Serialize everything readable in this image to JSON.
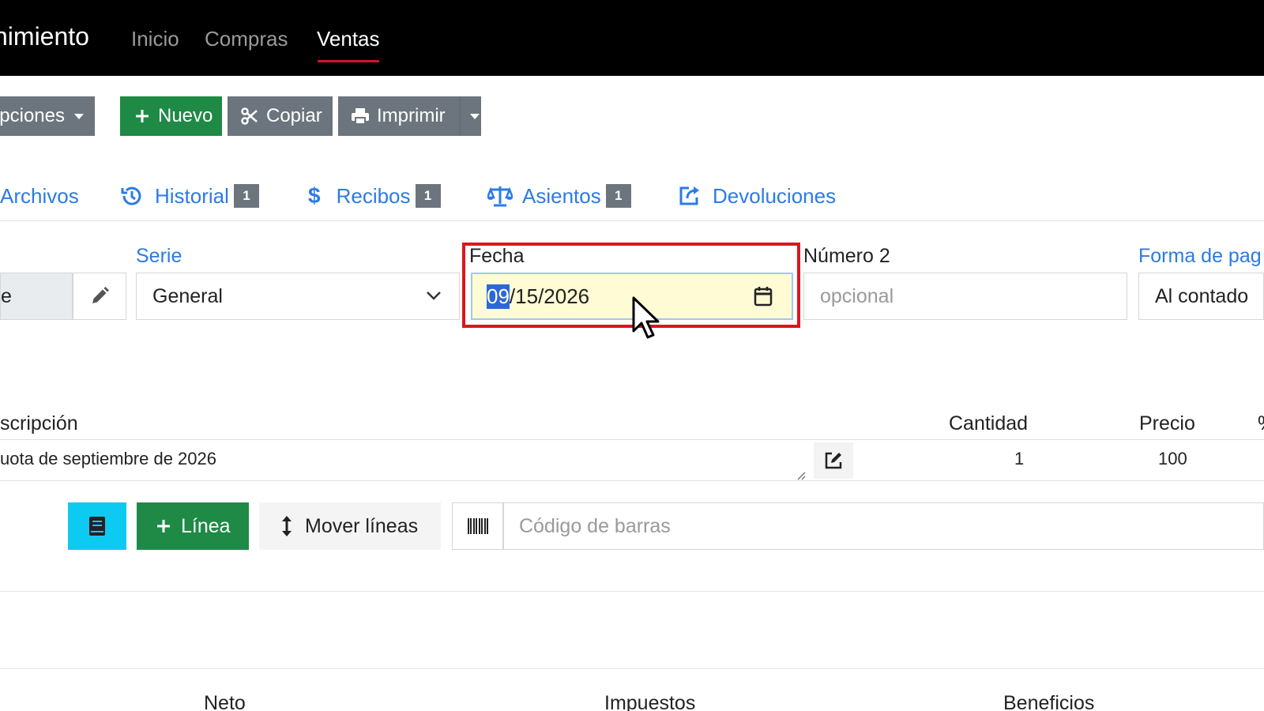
{
  "navbar": {
    "brand": "nimiento",
    "links": [
      {
        "label": "Inicio"
      },
      {
        "label": "Compras"
      },
      {
        "label": "Ventas",
        "active": true
      }
    ]
  },
  "toolbar": {
    "options_label": "pciones",
    "new_label": "Nuevo",
    "copy_label": "Copiar",
    "print_label": "Imprimir"
  },
  "tabs": [
    {
      "label": "Archivos",
      "icon": "paperclip-icon"
    },
    {
      "label": "Historial",
      "badge": "1",
      "icon": "history-icon"
    },
    {
      "label": "Recibos",
      "badge": "1",
      "icon": "dollar-icon"
    },
    {
      "label": "Asientos",
      "badge": "1",
      "icon": "balance-scale-icon"
    },
    {
      "label": "Devoluciones",
      "icon": "share-icon"
    }
  ],
  "form": {
    "customer_value": "e",
    "serie_label": "Serie",
    "serie_value": "General",
    "fecha_label": "Fecha",
    "fecha_month": "09",
    "fecha_rest": "/15/2026",
    "numero2_label": "Número 2",
    "numero2_placeholder": "opcional",
    "forma_pago_label": "Forma de pag",
    "forma_pago_value": "Al contado"
  },
  "lines": {
    "headers": {
      "descripcion": "scripción",
      "cantidad": "Cantidad",
      "precio": "Precio",
      "pct": "%"
    },
    "rows": [
      {
        "descripcion": "uota de septiembre de 2026",
        "cantidad": "1",
        "precio": "100"
      }
    ]
  },
  "line_actions": {
    "add_line_label": "Línea",
    "move_lines_label": "Mover líneas",
    "barcode_placeholder": "Código de barras"
  },
  "totals": {
    "neto": "Neto",
    "impuestos": "Impuestos",
    "beneficios": "Beneficios"
  },
  "colors": {
    "accent": "#2c7be5",
    "success": "#1e8a45",
    "secondary": "#6c757d",
    "info": "#0dcaf0",
    "highlight": "#e0141e"
  }
}
